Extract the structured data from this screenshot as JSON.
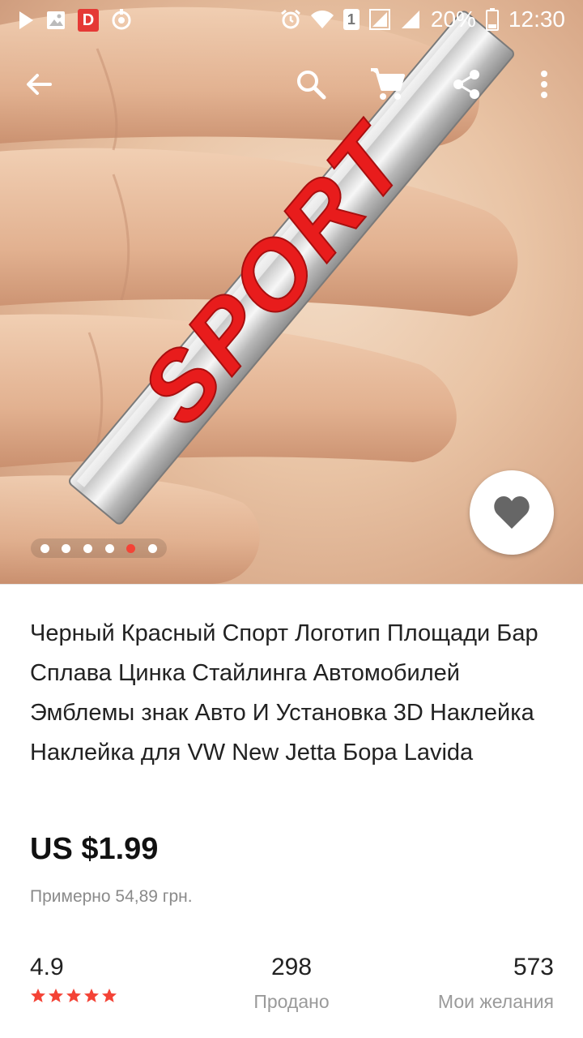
{
  "status_bar": {
    "battery_text": "20%",
    "time": "12:30",
    "sim_slot": "1",
    "app_badge": "D",
    "icons": [
      "play-store-icon",
      "gallery-icon",
      "d-app-icon",
      "sync-icon",
      "alarm-icon",
      "wifi-icon",
      "sim-icon",
      "signal-icon",
      "battery-icon"
    ]
  },
  "app_bar": {
    "icons": [
      "back-arrow-icon",
      "search-icon",
      "cart-icon",
      "share-icon",
      "more-vert-icon"
    ]
  },
  "gallery": {
    "image_text": "SPORT",
    "image_count": 6,
    "active_index": 4
  },
  "product": {
    "title": "Черный Красный Спорт Логотип Площади Бар Сплава Цинка Стайлинга Автомобилей Эмблемы знак Авто И Установка 3D Наклейка Наклейка для VW New Jetta Бора Lavida",
    "price": "US $1.99",
    "approx_price": "Примерно 54,89 грн."
  },
  "stats": {
    "rating": "4.9",
    "rating_stars": 5,
    "sold_count": "298",
    "sold_label": "Продано",
    "wishlist_count": "573",
    "wishlist_label": "Мои желания"
  },
  "colors": {
    "accent_red": "#f44336",
    "star_red": "#f44336",
    "text_dark": "#222222",
    "text_gray": "#9a9a9a",
    "heart_gray": "#666666"
  }
}
